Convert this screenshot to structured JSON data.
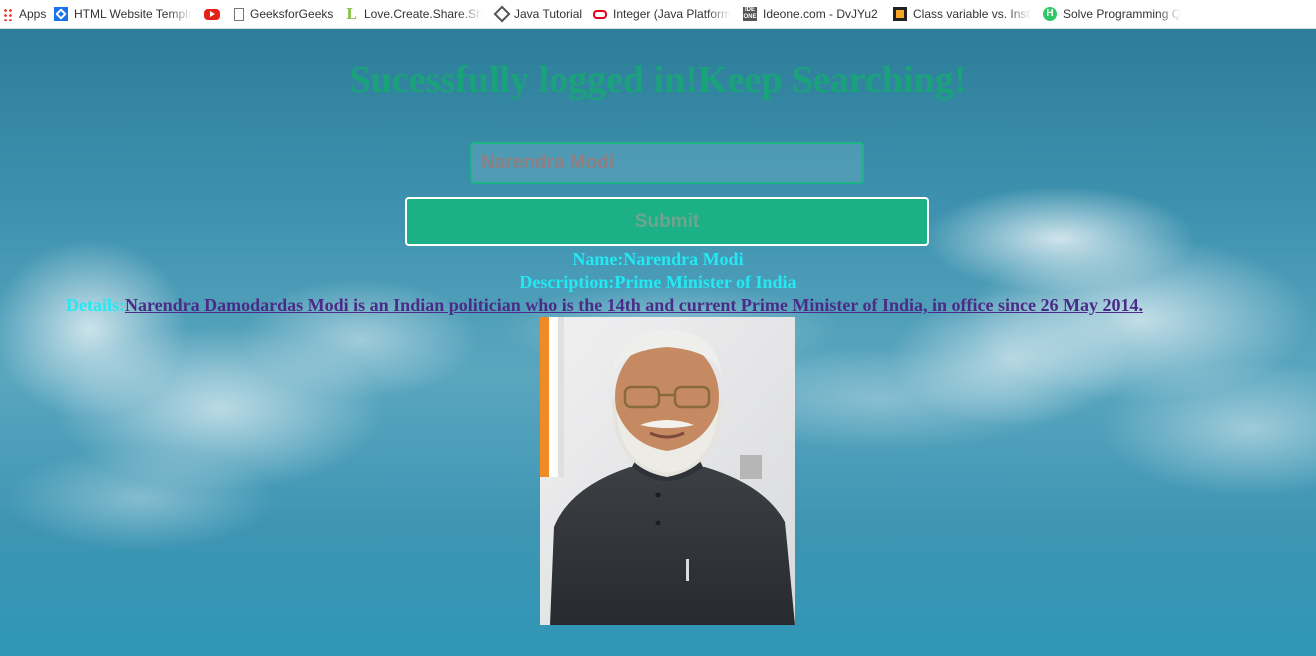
{
  "bookmarks": [
    {
      "label": "Apps",
      "icon": "apps-grid-icon"
    },
    {
      "label": "HTML Website Templa",
      "icon": "html-template-icon"
    },
    {
      "label": "",
      "icon": "youtube-icon"
    },
    {
      "label": "GeeksforGeeks",
      "icon": "document-icon"
    },
    {
      "label": "Love.Create.Share.Sho",
      "icon": "l-logo-icon"
    },
    {
      "label": "Java Tutorial",
      "icon": "diamond-icon"
    },
    {
      "label": "Integer (Java Platform",
      "icon": "oracle-icon"
    },
    {
      "label": "Ideone.com - DvJYu2",
      "icon": "ideone-icon"
    },
    {
      "label": "Class variable vs. Insta",
      "icon": "class-variable-icon"
    },
    {
      "label": "Solve Programming Q",
      "icon": "hackerrank-icon"
    }
  ],
  "page": {
    "heading": "Sucessfully logged in!Keep Searching!",
    "search_value": "Narendra Modi",
    "submit_label": "Submit",
    "name_label": "Name:",
    "name_value": "Narendra Modi",
    "description_label": "Description:",
    "description_value": "Prime Minister of India",
    "details_label": "Details:",
    "details_value": "Narendra Damodardas Modi is an Indian politician who is the 14th and current Prime Minister of India, in office since 26 May 2014. "
  },
  "colors": {
    "heading": "#1aa37a",
    "submit_bg": "#1bb085",
    "info_text": "#23e9f3",
    "details_link": "#4b2b87"
  }
}
